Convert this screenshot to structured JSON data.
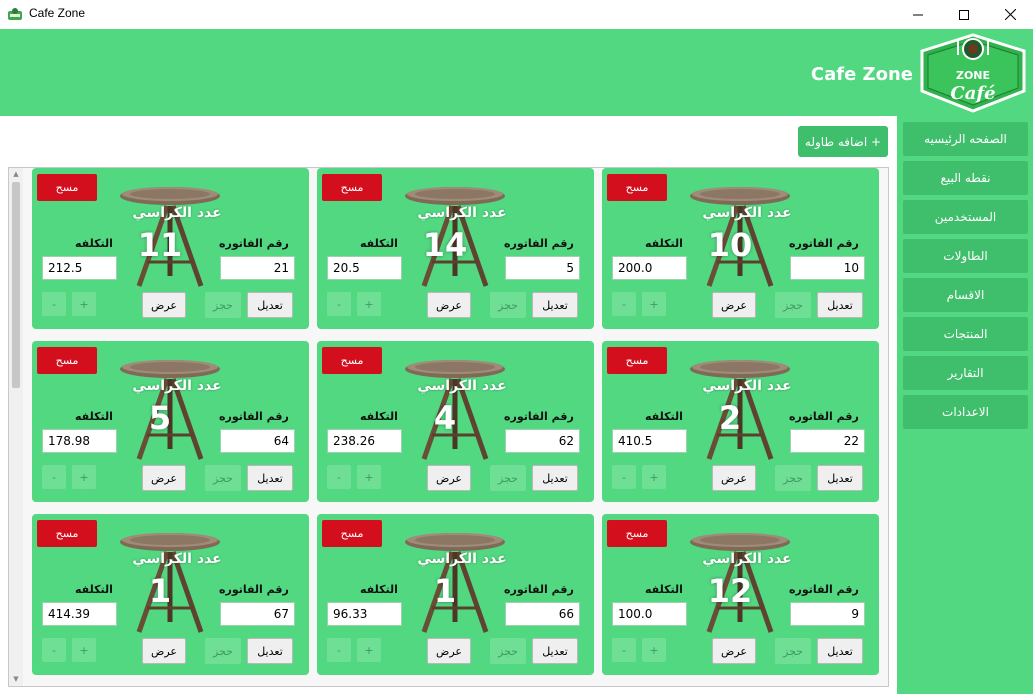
{
  "window": {
    "title": "Cafe Zone",
    "controls": {
      "minimize": "—",
      "maximize": "☐",
      "close": "✕"
    }
  },
  "header": {
    "title": "Cafe Zone",
    "logo_text_top": "ZONE",
    "logo_text_bottom": "Café"
  },
  "sidebar": {
    "items": [
      {
        "label": "الصفحه الرئيسيه"
      },
      {
        "label": "نقطه البيع"
      },
      {
        "label": "المستخدمين"
      },
      {
        "label": "الطاولات"
      },
      {
        "label": "الاقسام"
      },
      {
        "label": "المنتجات"
      },
      {
        "label": "التقارير"
      },
      {
        "label": "الاعدادات"
      }
    ]
  },
  "main": {
    "add_table_label": "اضافه طاوله +"
  },
  "card_labels": {
    "delete": "مسح",
    "seats": "عدد الكراسي",
    "invoice_no": "رقم الفاتوره",
    "cost": "التكلفه",
    "minus": "-",
    "plus": "+",
    "view": "عرض",
    "book": "حجز",
    "edit": "تعديل"
  },
  "tables": [
    {
      "seats": "10",
      "invoice": "10",
      "cost": "200.0"
    },
    {
      "seats": "14",
      "invoice": "5",
      "cost": "20.5"
    },
    {
      "seats": "11",
      "invoice": "21",
      "cost": "212.5"
    },
    {
      "seats": "2",
      "invoice": "22",
      "cost": "410.5"
    },
    {
      "seats": "4",
      "invoice": "62",
      "cost": "238.26"
    },
    {
      "seats": "5",
      "invoice": "64",
      "cost": "178.98"
    },
    {
      "seats": "12",
      "invoice": "9",
      "cost": "100.0"
    },
    {
      "seats": "1",
      "invoice": "66",
      "cost": "96.33"
    },
    {
      "seats": "1",
      "invoice": "67",
      "cost": "414.39"
    }
  ],
  "colors": {
    "brand_green": "#51d880",
    "button_green": "#3fbf6b",
    "delete_red": "#d40f1d"
  }
}
